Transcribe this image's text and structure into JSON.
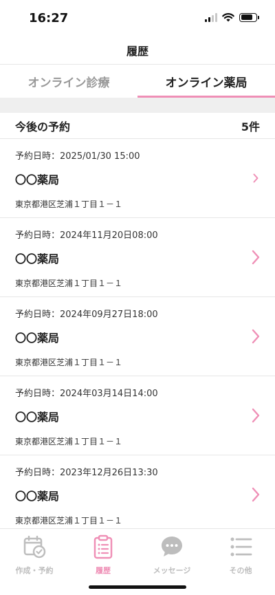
{
  "status_bar": {
    "time": "16:27"
  },
  "header": {
    "title": "履歴"
  },
  "tabs": [
    {
      "label": "オンライン診療",
      "active": false
    },
    {
      "label": "オンライン薬局",
      "active": true
    }
  ],
  "section": {
    "title": "今後の予約",
    "count": "5件"
  },
  "reservations": [
    {
      "date": "予約日時：2025/01/30  15:00",
      "name": "〇〇薬局",
      "address": "東京都港区芝浦１丁目１－１"
    },
    {
      "date": "予約日時：2024年11月20日08:00",
      "name": "〇〇薬局",
      "address": "東京都港区芝浦１丁目１－１"
    },
    {
      "date": "予約日時：2024年09月27日18:00",
      "name": "〇〇薬局",
      "address": "東京都港区芝浦１丁目１－１"
    },
    {
      "date": "予約日時：2024年03月14日14:00",
      "name": "〇〇薬局",
      "address": "東京都港区芝浦１丁目１－１"
    },
    {
      "date": "予約日時：2023年12月26日13:30",
      "name": "〇〇薬局",
      "address": "東京都港区芝浦１丁目１－１"
    }
  ],
  "tab_bar": [
    {
      "label": "作成・予約",
      "icon": "calendar-check-icon",
      "active": false
    },
    {
      "label": "履歴",
      "icon": "clipboard-list-icon",
      "active": true
    },
    {
      "label": "メッセージ",
      "icon": "chat-bubble-icon",
      "active": false
    },
    {
      "label": "その他",
      "icon": "list-menu-icon",
      "active": false
    }
  ],
  "colors": {
    "accent": "#ef8fb6",
    "inactive": "#bdbdbd",
    "band": "#efefef"
  }
}
